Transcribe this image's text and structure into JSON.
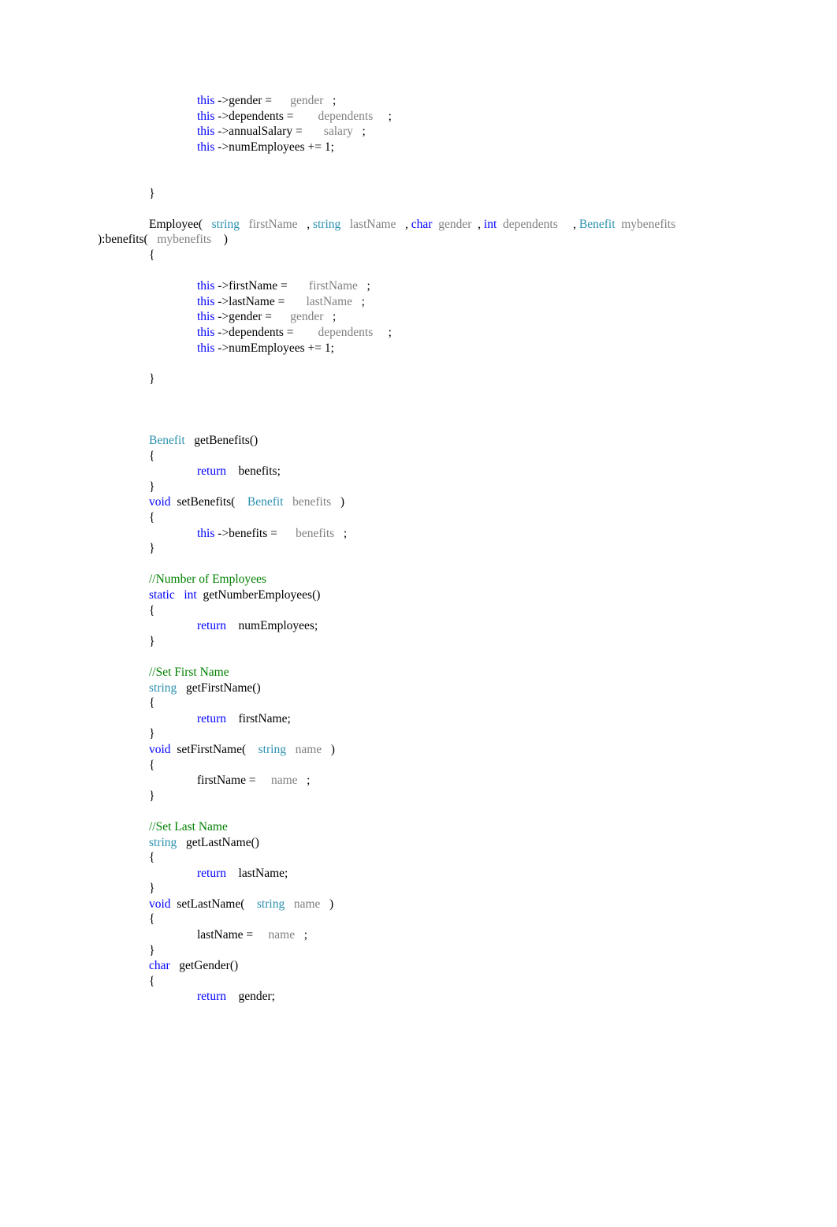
{
  "document": {
    "kind": "source-code-listing",
    "language": "C++",
    "page_background": "#ffffff",
    "font_style": "serif",
    "colors": {
      "keyword": "#0000ff",
      "type": "#2b91af",
      "parameter": "#808080",
      "comment": "#008000",
      "plain": "#000000",
      "background": "#ffffff"
    }
  },
  "code": {
    "lines": [
      {
        "indent": 2,
        "tokens": [
          {
            "t": "this",
            "c": "kw"
          },
          {
            "t": " ->gender = ",
            "c": "plain"
          },
          {
            "t": "     gender",
            "c": "param"
          },
          {
            "t": "   ;",
            "c": "plain"
          }
        ]
      },
      {
        "indent": 2,
        "tokens": [
          {
            "t": "this",
            "c": "kw"
          },
          {
            "t": " ->dependents = ",
            "c": "plain"
          },
          {
            "t": "       dependents",
            "c": "param"
          },
          {
            "t": "     ;",
            "c": "plain"
          }
        ]
      },
      {
        "indent": 2,
        "tokens": [
          {
            "t": "this",
            "c": "kw"
          },
          {
            "t": " ->annualSalary = ",
            "c": "plain"
          },
          {
            "t": "      salary",
            "c": "param"
          },
          {
            "t": "   ;",
            "c": "plain"
          }
        ]
      },
      {
        "indent": 2,
        "tokens": [
          {
            "t": "this",
            "c": "kw"
          },
          {
            "t": " ->numEmployees += 1;",
            "c": "plain"
          }
        ]
      },
      {
        "indent": 0,
        "tokens": []
      },
      {
        "indent": 0,
        "tokens": []
      },
      {
        "indent": 1,
        "tokens": [
          {
            "t": "}",
            "c": "plain"
          }
        ]
      },
      {
        "indent": 0,
        "tokens": []
      },
      {
        "indent": 1,
        "wrap": true,
        "tokens": [
          {
            "t": "Employee(",
            "c": "plain"
          },
          {
            "t": "   string",
            "c": "type"
          },
          {
            "t": "   firstName",
            "c": "param"
          },
          {
            "t": "   , ",
            "c": "plain"
          },
          {
            "t": "string",
            "c": "type"
          },
          {
            "t": "   lastName",
            "c": "param"
          },
          {
            "t": "   , ",
            "c": "plain"
          },
          {
            "t": "char",
            "c": "kw"
          },
          {
            "t": "  gender",
            "c": "param"
          },
          {
            "t": "  , ",
            "c": "plain"
          },
          {
            "t": "int",
            "c": "kw"
          },
          {
            "t": "  dependents",
            "c": "param"
          },
          {
            "t": "     , ",
            "c": "plain"
          },
          {
            "t": "Benefit",
            "c": "type"
          },
          {
            "t": "  mybenefits",
            "c": "param"
          },
          {
            "t": "    ):benefits(",
            "c": "plain"
          },
          {
            "t": "   mybenefits",
            "c": "param"
          },
          {
            "t": "    )",
            "c": "plain"
          }
        ]
      },
      {
        "indent": 1,
        "tokens": [
          {
            "t": "{",
            "c": "plain"
          }
        ]
      },
      {
        "indent": 0,
        "tokens": []
      },
      {
        "indent": 2,
        "tokens": [
          {
            "t": "this",
            "c": "kw"
          },
          {
            "t": " ->firstName = ",
            "c": "plain"
          },
          {
            "t": "      firstName",
            "c": "param"
          },
          {
            "t": "   ;",
            "c": "plain"
          }
        ]
      },
      {
        "indent": 2,
        "tokens": [
          {
            "t": "this",
            "c": "kw"
          },
          {
            "t": " ->lastName = ",
            "c": "plain"
          },
          {
            "t": "      lastName",
            "c": "param"
          },
          {
            "t": "   ;",
            "c": "plain"
          }
        ]
      },
      {
        "indent": 2,
        "tokens": [
          {
            "t": "this",
            "c": "kw"
          },
          {
            "t": " ->gender = ",
            "c": "plain"
          },
          {
            "t": "     gender",
            "c": "param"
          },
          {
            "t": "   ;",
            "c": "plain"
          }
        ]
      },
      {
        "indent": 2,
        "tokens": [
          {
            "t": "this",
            "c": "kw"
          },
          {
            "t": " ->dependents = ",
            "c": "plain"
          },
          {
            "t": "       dependents",
            "c": "param"
          },
          {
            "t": "     ;",
            "c": "plain"
          }
        ]
      },
      {
        "indent": 2,
        "tokens": [
          {
            "t": "this",
            "c": "kw"
          },
          {
            "t": " ->numEmployees += 1;",
            "c": "plain"
          }
        ]
      },
      {
        "indent": 0,
        "tokens": []
      },
      {
        "indent": 1,
        "tokens": [
          {
            "t": "}",
            "c": "plain"
          }
        ]
      },
      {
        "indent": 0,
        "tokens": []
      },
      {
        "indent": 0,
        "tokens": []
      },
      {
        "indent": 0,
        "tokens": []
      },
      {
        "indent": 1,
        "tokens": [
          {
            "t": "Benefit",
            "c": "type"
          },
          {
            "t": "   getBenefits()",
            "c": "plain"
          }
        ]
      },
      {
        "indent": 1,
        "tokens": [
          {
            "t": "{",
            "c": "plain"
          }
        ]
      },
      {
        "indent": 2,
        "tokens": [
          {
            "t": "return",
            "c": "kw"
          },
          {
            "t": "    benefits;",
            "c": "plain"
          }
        ]
      },
      {
        "indent": 1,
        "tokens": [
          {
            "t": "}",
            "c": "plain"
          }
        ]
      },
      {
        "indent": 1,
        "tokens": [
          {
            "t": "void",
            "c": "kw"
          },
          {
            "t": "  setBenefits(",
            "c": "plain"
          },
          {
            "t": "    Benefit",
            "c": "type"
          },
          {
            "t": "   benefits",
            "c": "param"
          },
          {
            "t": "   )",
            "c": "plain"
          }
        ]
      },
      {
        "indent": 1,
        "tokens": [
          {
            "t": "{",
            "c": "plain"
          }
        ]
      },
      {
        "indent": 2,
        "tokens": [
          {
            "t": "this",
            "c": "kw"
          },
          {
            "t": " ->benefits = ",
            "c": "plain"
          },
          {
            "t": "     benefits",
            "c": "param"
          },
          {
            "t": "   ;",
            "c": "plain"
          }
        ]
      },
      {
        "indent": 1,
        "tokens": [
          {
            "t": "}",
            "c": "plain"
          }
        ]
      },
      {
        "indent": 0,
        "tokens": []
      },
      {
        "indent": 1,
        "tokens": [
          {
            "t": "//Number of Employees",
            "c": "comment"
          }
        ]
      },
      {
        "indent": 1,
        "tokens": [
          {
            "t": "static",
            "c": "kw"
          },
          {
            "t": "   ",
            "c": "plain"
          },
          {
            "t": "int",
            "c": "kw"
          },
          {
            "t": "  getNumberEmployees()",
            "c": "plain"
          }
        ]
      },
      {
        "indent": 1,
        "tokens": [
          {
            "t": "{",
            "c": "plain"
          }
        ]
      },
      {
        "indent": 2,
        "tokens": [
          {
            "t": "return",
            "c": "kw"
          },
          {
            "t": "    numEmployees;",
            "c": "plain"
          }
        ]
      },
      {
        "indent": 1,
        "tokens": [
          {
            "t": "}",
            "c": "plain"
          }
        ]
      },
      {
        "indent": 0,
        "tokens": []
      },
      {
        "indent": 1,
        "tokens": [
          {
            "t": "//Set First Name",
            "c": "comment"
          }
        ]
      },
      {
        "indent": 1,
        "tokens": [
          {
            "t": "string",
            "c": "type"
          },
          {
            "t": "   getFirstName()",
            "c": "plain"
          }
        ]
      },
      {
        "indent": 1,
        "tokens": [
          {
            "t": "{",
            "c": "plain"
          }
        ]
      },
      {
        "indent": 2,
        "tokens": [
          {
            "t": "return",
            "c": "kw"
          },
          {
            "t": "    firstName;",
            "c": "plain"
          }
        ]
      },
      {
        "indent": 1,
        "tokens": [
          {
            "t": "}",
            "c": "plain"
          }
        ]
      },
      {
        "indent": 1,
        "tokens": [
          {
            "t": "void",
            "c": "kw"
          },
          {
            "t": "  setFirstName(",
            "c": "plain"
          },
          {
            "t": "    string",
            "c": "type"
          },
          {
            "t": "   name",
            "c": "param"
          },
          {
            "t": "   )",
            "c": "plain"
          }
        ]
      },
      {
        "indent": 1,
        "tokens": [
          {
            "t": "{",
            "c": "plain"
          }
        ]
      },
      {
        "indent": 2,
        "tokens": [
          {
            "t": "firstName = ",
            "c": "plain"
          },
          {
            "t": "    name",
            "c": "param"
          },
          {
            "t": "   ;",
            "c": "plain"
          }
        ]
      },
      {
        "indent": 1,
        "tokens": [
          {
            "t": "}",
            "c": "plain"
          }
        ]
      },
      {
        "indent": 0,
        "tokens": []
      },
      {
        "indent": 1,
        "tokens": [
          {
            "t": "//Set Last Name",
            "c": "comment"
          }
        ]
      },
      {
        "indent": 1,
        "tokens": [
          {
            "t": "string",
            "c": "type"
          },
          {
            "t": "   getLastName()",
            "c": "plain"
          }
        ]
      },
      {
        "indent": 1,
        "tokens": [
          {
            "t": "{",
            "c": "plain"
          }
        ]
      },
      {
        "indent": 2,
        "tokens": [
          {
            "t": "return",
            "c": "kw"
          },
          {
            "t": "    lastName;",
            "c": "plain"
          }
        ]
      },
      {
        "indent": 1,
        "tokens": [
          {
            "t": "}",
            "c": "plain"
          }
        ]
      },
      {
        "indent": 1,
        "tokens": [
          {
            "t": "void",
            "c": "kw"
          },
          {
            "t": "  setLastName(",
            "c": "plain"
          },
          {
            "t": "    string",
            "c": "type"
          },
          {
            "t": "   name",
            "c": "param"
          },
          {
            "t": "   )",
            "c": "plain"
          }
        ]
      },
      {
        "indent": 1,
        "tokens": [
          {
            "t": "{",
            "c": "plain"
          }
        ]
      },
      {
        "indent": 2,
        "tokens": [
          {
            "t": "lastName = ",
            "c": "plain"
          },
          {
            "t": "    name",
            "c": "param"
          },
          {
            "t": "   ;",
            "c": "plain"
          }
        ]
      },
      {
        "indent": 1,
        "tokens": [
          {
            "t": "}",
            "c": "plain"
          }
        ]
      },
      {
        "indent": 1,
        "tokens": [
          {
            "t": "char",
            "c": "kw"
          },
          {
            "t": "   getGender()",
            "c": "plain"
          }
        ]
      },
      {
        "indent": 1,
        "tokens": [
          {
            "t": "{",
            "c": "plain"
          }
        ]
      },
      {
        "indent": 2,
        "tokens": [
          {
            "t": "return",
            "c": "kw"
          },
          {
            "t": "    gender;",
            "c": "plain"
          }
        ]
      }
    ]
  }
}
